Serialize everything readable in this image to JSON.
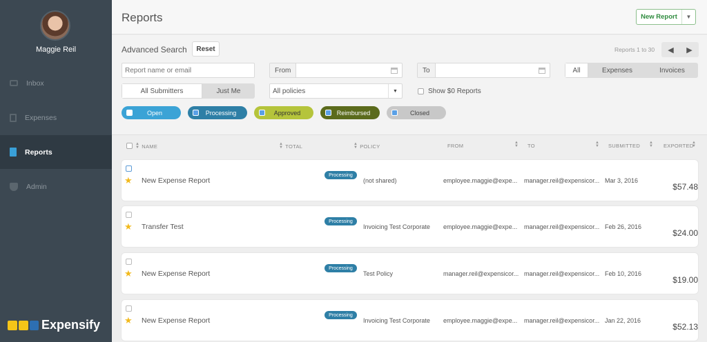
{
  "sidebar": {
    "user_name": "Maggie Reil",
    "items": [
      {
        "label": "Inbox"
      },
      {
        "label": "Expenses"
      },
      {
        "label": "Reports"
      },
      {
        "label": "Admin"
      }
    ],
    "logo_text": "Expensify"
  },
  "header": {
    "title": "Reports",
    "new_report_label": "New Report"
  },
  "search": {
    "title": "Advanced Search",
    "reset_label": "Reset",
    "pager_text": "Reports 1 to 30",
    "name_placeholder": "Report name or email",
    "from_label": "From",
    "to_label": "To",
    "type_tabs": [
      "All",
      "Expenses",
      "Invoices"
    ],
    "submitter_tabs": [
      "All Submitters",
      "Just Me"
    ],
    "policy_select": "All policies",
    "show_zero_label": "Show $0 Reports",
    "status_filters": [
      {
        "label": "Open",
        "checked": false,
        "color": "#3ba3d6"
      },
      {
        "label": "Processing",
        "checked": true,
        "color": "#2e7fa6"
      },
      {
        "label": "Approved",
        "checked": true,
        "color": "#b5c43b"
      },
      {
        "label": "Reimbursed",
        "checked": true,
        "color": "#5b6b1c"
      },
      {
        "label": "Closed",
        "checked": true,
        "color": "#c8c8c8"
      }
    ]
  },
  "table": {
    "columns": [
      "NAME",
      "TOTAL",
      "POLICY",
      "FROM",
      "TO",
      "SUBMITTED",
      "EXPORTED"
    ],
    "rows": [
      {
        "name": "New Expense Report",
        "status": "Processing",
        "total": "$57.48",
        "policy": "(not shared)",
        "from": "employee.maggie@expe...",
        "to": "manager.reil@expensicor...",
        "submitted": "Mar 3, 2016"
      },
      {
        "name": "Transfer Test",
        "status": "Processing",
        "total": "$24.00",
        "policy": "Invoicing Test Corporate",
        "from": "employee.maggie@expe...",
        "to": "manager.reil@expensicor...",
        "submitted": "Feb 26, 2016"
      },
      {
        "name": "New Expense Report",
        "status": "Processing",
        "total": "$19.00",
        "policy": "Test Policy",
        "from": "manager.reil@expensicor...",
        "to": "manager.reil@expensicor...",
        "submitted": "Feb 10, 2016"
      },
      {
        "name": "New Expense Report",
        "status": "Processing",
        "total": "$52.13",
        "policy": "Invoicing Test Corporate",
        "from": "employee.maggie@expe...",
        "to": "manager.reil@expensicor...",
        "submitted": "Jan 22, 2016"
      }
    ]
  }
}
